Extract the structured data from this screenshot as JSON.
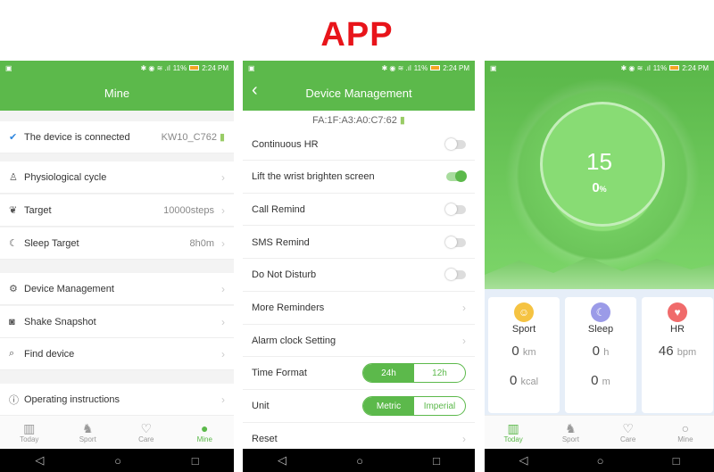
{
  "heading": "APP",
  "status": {
    "time": "2:24 PM",
    "battery": "11%"
  },
  "mine": {
    "title": "Mine",
    "connected": "The device is connected",
    "device": "KW10_C762",
    "items": [
      {
        "label": "Physiological cycle",
        "icon": "person-icon",
        "value": ""
      },
      {
        "label": "Target",
        "icon": "footprint-icon",
        "value": "10000steps"
      },
      {
        "label": "Sleep Target",
        "icon": "moon-icon",
        "value": "8h0m"
      },
      {
        "label": "Device Management",
        "icon": "gear-icon",
        "value": ""
      },
      {
        "label": "Shake Snapshot",
        "icon": "camera-icon",
        "value": ""
      },
      {
        "label": "Find device",
        "icon": "search-icon",
        "value": ""
      },
      {
        "label": "Operating instructions",
        "icon": "info-icon",
        "value": ""
      }
    ]
  },
  "device": {
    "title": "Device Management",
    "mac": "FA:1F:A3:A0:C7:62",
    "toggles": [
      {
        "label": "Continuous HR",
        "on": false
      },
      {
        "label": "Lift the wrist brighten screen",
        "on": true
      },
      {
        "label": "Call Remind",
        "on": false
      },
      {
        "label": "SMS Remind",
        "on": false
      },
      {
        "label": "Do Not Disturb",
        "on": false
      }
    ],
    "links": [
      "More Reminders",
      "Alarm clock Setting"
    ],
    "time_format": {
      "label": "Time Format",
      "options": [
        "24h",
        "12h"
      ],
      "selected": "24h"
    },
    "unit": {
      "label": "Unit",
      "options": [
        "Metric",
        "Imperial"
      ],
      "selected": "Metric"
    },
    "reset": "Reset"
  },
  "today": {
    "steps": "15",
    "percent": "0",
    "percent_unit": "%",
    "cards": [
      {
        "label": "Sport",
        "color": "#f5c342",
        "v1": "0",
        "u1": "km",
        "v2": "0",
        "u2": "kcal"
      },
      {
        "label": "Sleep",
        "color": "#9b9be8",
        "v1": "0",
        "u1": "h",
        "v2": "0",
        "u2": "m"
      },
      {
        "label": "HR",
        "color": "#f06b6b",
        "v1": "46",
        "u1": "bpm",
        "v2": "",
        "u2": ""
      }
    ]
  },
  "tabs": [
    "Today",
    "Sport",
    "Care",
    "Mine"
  ],
  "accent": "#5cb94b"
}
